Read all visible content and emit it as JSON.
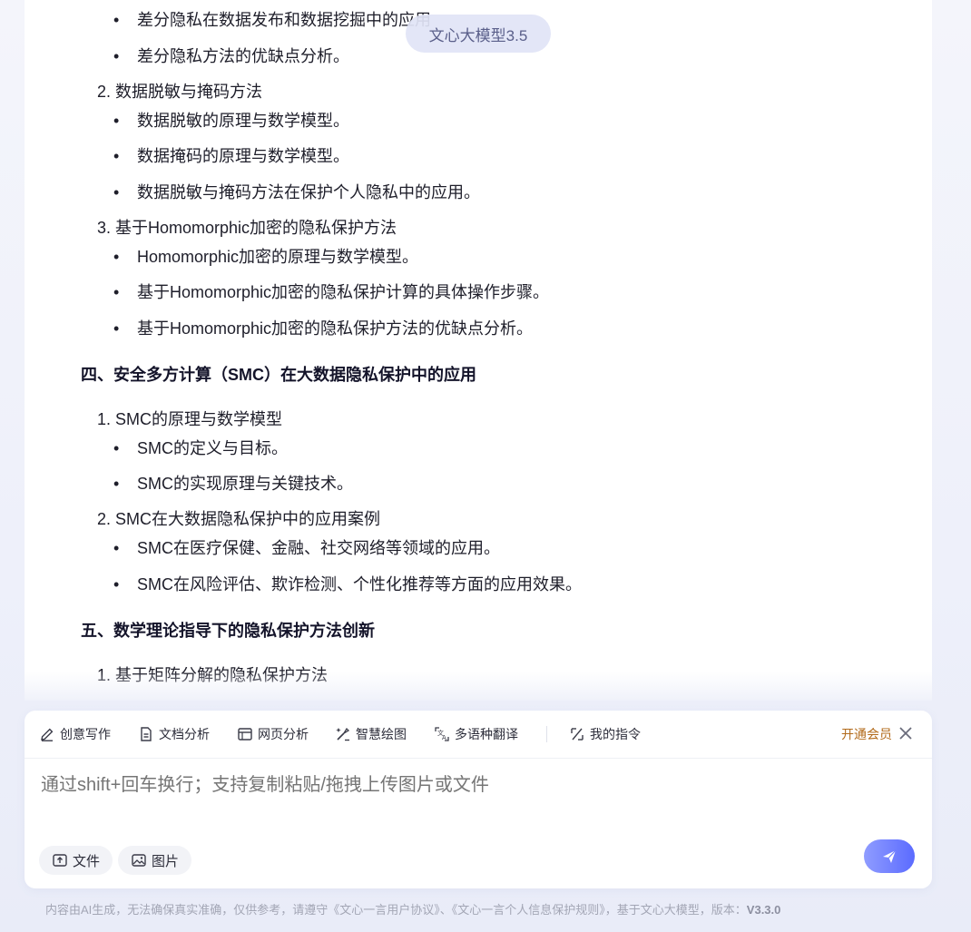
{
  "model_badge": "文心大模型3.5",
  "content": {
    "s3_b1": "差分隐私在数据发布和数据挖掘中的应用",
    "s3_b2": "差分隐私方法的优缺点分析。",
    "s3_n2": "2. 数据脱敏与掩码方法",
    "s3_n2_b1": "数据脱敏的原理与数学模型。",
    "s3_n2_b2": "数据掩码的原理与数学模型。",
    "s3_n2_b3": "数据脱敏与掩码方法在保护个人隐私中的应用。",
    "s3_n3": "3. 基于Homomorphic加密的隐私保护方法",
    "s3_n3_b1": "Homomorphic加密的原理与数学模型。",
    "s3_n3_b2": "基于Homomorphic加密的隐私保护计算的具体操作步骤。",
    "s3_n3_b3": "基于Homomorphic加密的隐私保护方法的优缺点分析。",
    "h4": "四、安全多方计算（SMC）在大数据隐私保护中的应用",
    "s4_n1": "1. SMC的原理与数学模型",
    "s4_n1_b1": "SMC的定义与目标。",
    "s4_n1_b2": "SMC的实现原理与关键技术。",
    "s4_n2": "2. SMC在大数据隐私保护中的应用案例",
    "s4_n2_b1": "SMC在医疗保健、金融、社交网络等领域的应用。",
    "s4_n2_b2": "SMC在风险评估、欺诈检测、个性化推荐等方面的应用效果。",
    "h5": "五、数学理论指导下的隐私保护方法创新",
    "s5_n1": "1. 基于矩阵分解的隐私保护方法",
    "bullet": "•"
  },
  "toolbar": {
    "creative_writing": "创意写作",
    "doc_analysis": "文档分析",
    "web_analysis": "网页分析",
    "smart_drawing": "智慧绘图",
    "translation": "多语种翻译",
    "my_commands": "我的指令",
    "vip": "开通会员"
  },
  "input": {
    "placeholder": "通过shift+回车换行；支持复制粘贴/拖拽上传图片或文件"
  },
  "chips": {
    "file": "文件",
    "image": "图片"
  },
  "footer": {
    "text": "内容由AI生成，无法确保真实准确，仅供参考，请遵守《文心一言用户协议》、《文心一言个人信息保护规则》，基于文心大模型，版本：",
    "version": "V3.3.0"
  },
  "colors": {
    "accent_start": "#8f9cff",
    "accent_end": "#5b6bff",
    "vip": "#b26a1a"
  }
}
